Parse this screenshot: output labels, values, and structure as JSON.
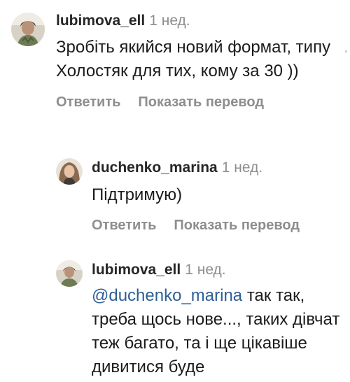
{
  "comments": [
    {
      "username": "lubimova_ell",
      "time": "1 нед.",
      "text": "Зробіть якийся новий формат, типу Холостяк для тих, кому за 30 ))",
      "reply_label": "Ответить",
      "translate_label": "Показать перевод"
    },
    {
      "username": "duchenko_marina",
      "time": "1 нед.",
      "text": "Підтримую)",
      "reply_label": "Ответить",
      "translate_label": "Показать перевод"
    },
    {
      "username": "lubimova_ell",
      "time": "1 нед.",
      "mention": "@duchenko_marina",
      "text": " так так, треба щось нове..., таких дівчат теж багато, та і ще цікавіше дивитися буде"
    }
  ],
  "colors": {
    "text": "#262626",
    "secondary": "#8e8e8e",
    "mention": "#2d5f95"
  }
}
